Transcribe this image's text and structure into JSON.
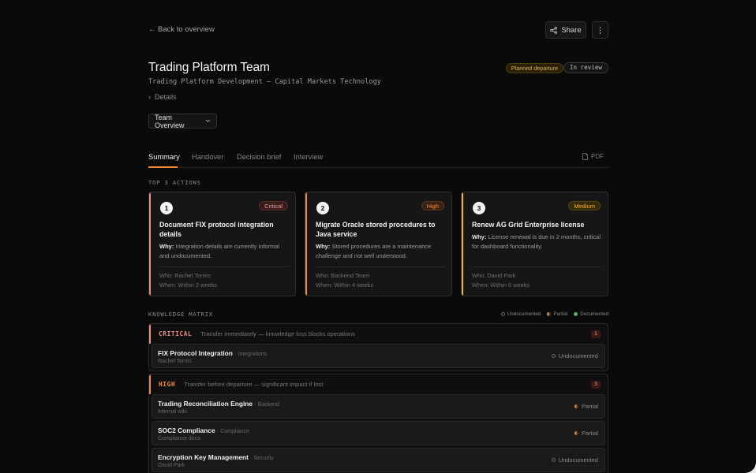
{
  "nav": {
    "back_label": "Back to overview",
    "share_label": "Share"
  },
  "header": {
    "title": "Trading Platform Team",
    "subtitle": "Trading Platform Development — Capital Markets Technology",
    "badges": {
      "planned": "Planned departure",
      "review": "In review"
    },
    "details_label": "Details",
    "view_select": "Team Overview"
  },
  "tabs": [
    {
      "label": "Summary",
      "active": true
    },
    {
      "label": "Handover"
    },
    {
      "label": "Decision brief"
    },
    {
      "label": "Interview"
    }
  ],
  "pdf_label": "PDF",
  "actions_label": "TOP 3 ACTIONS",
  "actions": [
    {
      "num": "1",
      "priority": "Critical",
      "title": "Document FIX protocol integration details",
      "why_label": "Why:",
      "why": "Integration details are currently informal and undocumented.",
      "who": "Who: Rachel Torres",
      "when": "When: Within 2 weeks"
    },
    {
      "num": "2",
      "priority": "High",
      "title": "Migrate Oracle stored procedures to Java service",
      "why_label": "Why:",
      "why": "Stored procedures are a maintenance challenge and not well understood.",
      "who": "Who: Backend Team",
      "when": "When: Within 4 weeks"
    },
    {
      "num": "3",
      "priority": "Medium",
      "title": "Renew AG Grid Enterprise license",
      "why_label": "Why:",
      "why": "License renewal is due in 2 months, critical for dashboard functionality.",
      "who": "Who: David Park",
      "when": "When: Within 6 weeks"
    }
  ],
  "matrix_label": "KNOWLEDGE MATRIX",
  "legend": {
    "undocumented": "Undocumented",
    "partial": "Partial",
    "documented": "Documented"
  },
  "groups": [
    {
      "tag": "CRITICAL",
      "desc": "Transfer immediately — knowledge loss blocks operations",
      "count": "1",
      "rows": [
        {
          "name": "FIX Protocol Integration",
          "category": "· Integrations",
          "sub": "Rachel Torres",
          "status": "Undocumented"
        }
      ]
    },
    {
      "tag": "HIGH",
      "desc": "Transfer before departure — significant impact if lost",
      "count": "3",
      "rows": [
        {
          "name": "Trading Reconciliation Engine",
          "category": "· Backend",
          "sub": "Internal wiki",
          "status": "Partial"
        },
        {
          "name": "SOC2 Compliance",
          "category": "· Compliance",
          "sub": "Compliance docs",
          "status": "Partial"
        },
        {
          "name": "Encryption Key Management",
          "category": "· Security",
          "sub": "David Park",
          "status": "Undocumented"
        }
      ]
    }
  ],
  "colors": {
    "critical": "#f28b82",
    "high": "#ef8a3a",
    "medium": "#e9b43b",
    "tab_active": "#ef8a3a"
  }
}
